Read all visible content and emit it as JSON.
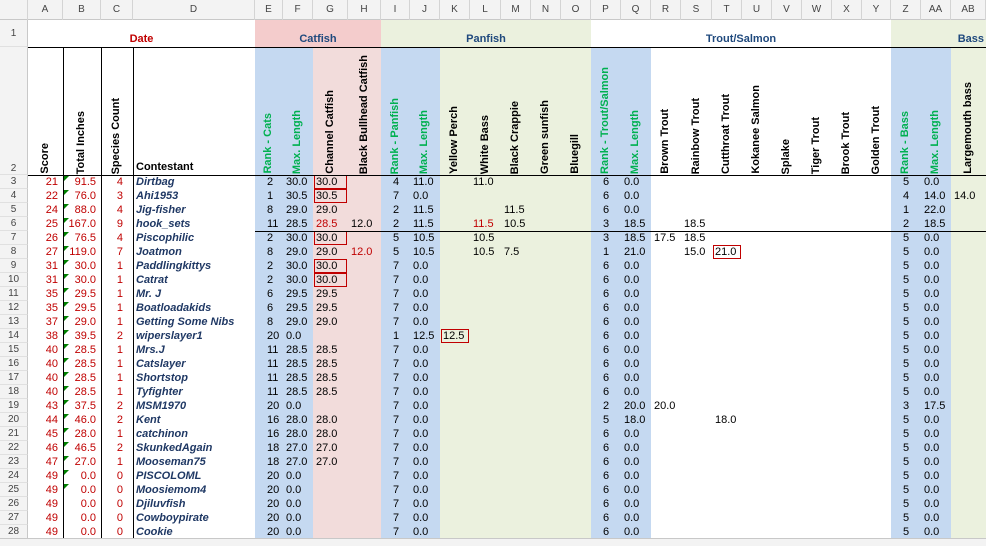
{
  "columns": [
    "A",
    "B",
    "C",
    "D",
    "E",
    "F",
    "G",
    "H",
    "I",
    "J",
    "K",
    "L",
    "M",
    "N",
    "O",
    "P",
    "Q",
    "R",
    "S",
    "T",
    "U",
    "V",
    "W",
    "X",
    "Y",
    "Z",
    "AA",
    "AB"
  ],
  "row_numbers": [
    "1",
    "2",
    "3",
    "4",
    "5",
    "6",
    "7",
    "8",
    "9",
    "10",
    "11",
    "12",
    "13",
    "14",
    "15",
    "16",
    "17",
    "18",
    "19",
    "20",
    "21",
    "22",
    "23",
    "24",
    "25",
    "26",
    "27",
    "28"
  ],
  "groups": {
    "date": "Date",
    "catfish": "Catfish",
    "panfish": "Panfish",
    "trout": "Trout/Salmon",
    "bass": "Bass"
  },
  "headers": {
    "score": "Score",
    "total_inches": "Total Inches",
    "species_count": "Species Count",
    "contestant": "Contestant",
    "rank_cats": "Rank - Cats",
    "max_len_cats": "Max. Length",
    "channel_catfish": "Channel Catfish",
    "black_bullhead": "Black Bullhead Catfish",
    "rank_panfish": "Rank - Panfish",
    "max_len_panfish": "Max. Length",
    "yellow_perch": "Yellow Perch",
    "white_bass": "White Bass",
    "black_crappie": "Black Crappie",
    "green_sunfish": "Green sunfish",
    "bluegill": "Bluegill",
    "rank_trout": "Rank - Trout/Salmon",
    "max_len_trout": "Max. Length",
    "brown_trout": "Brown Trout",
    "rainbow_trout": "Rainbow Trout",
    "cutthroat_trout": "Cutthroat Trout",
    "kokanee": "Kokanee Salmon",
    "splake": "Splake",
    "tiger_trout": "Tiger Trout",
    "brook_trout": "Brook Trout",
    "golden_trout": "Golden Trout",
    "rank_bass": "Rank - Bass",
    "max_len_bass": "Max. Length",
    "largemouth": "Largemouth bass"
  },
  "rows": [
    {
      "score": "21",
      "total": "91.5",
      "count": "4",
      "name": "Dirtbag",
      "e": "2",
      "f": "30.0",
      "g": "30.0",
      "h": "",
      "i": "4",
      "j": "11.0",
      "k": "",
      "l": "11.0",
      "m": "",
      "p": "6",
      "q": "0.0",
      "r": "",
      "s": "",
      "t": "",
      "z": "5",
      "aa": "0.0",
      "ab": ""
    },
    {
      "score": "22",
      "total": "76.0",
      "count": "3",
      "name": "Ahi1953",
      "e": "1",
      "f": "30.5",
      "g": "30.5",
      "h": "",
      "i": "7",
      "j": "0.0",
      "k": "",
      "l": "",
      "m": "",
      "p": "6",
      "q": "0.0",
      "r": "",
      "s": "",
      "t": "",
      "z": "4",
      "aa": "14.0",
      "ab": "14.0"
    },
    {
      "score": "24",
      "total": "88.0",
      "count": "4",
      "name": "Jig-fisher",
      "e": "8",
      "f": "29.0",
      "g": "29.0",
      "h": "",
      "i": "2",
      "j": "11.5",
      "k": "",
      "l": "",
      "m": "11.5",
      "p": "6",
      "q": "0.0",
      "r": "",
      "s": "",
      "t": "",
      "z": "1",
      "aa": "22.0",
      "ab": ""
    },
    {
      "score": "25",
      "total": "167.0",
      "count": "9",
      "name": "hook_sets",
      "e": "11",
      "f": "28.5",
      "g": "28.5",
      "h": "12.0",
      "i": "2",
      "j": "11.5",
      "k": "",
      "l": "11.5",
      "m": "10.5",
      "p": "3",
      "q": "18.5",
      "r": "",
      "s": "18.5",
      "t": "",
      "z": "2",
      "aa": "18.5",
      "ab": ""
    },
    {
      "score": "26",
      "total": "76.5",
      "count": "4",
      "name": "Piscophilic",
      "e": "2",
      "f": "30.0",
      "g": "30.0",
      "h": "",
      "i": "5",
      "j": "10.5",
      "k": "",
      "l": "10.5",
      "m": "",
      "p": "3",
      "q": "18.5",
      "r": "17.5",
      "s": "18.5",
      "t": "",
      "z": "5",
      "aa": "0.0",
      "ab": ""
    },
    {
      "score": "27",
      "total": "119.0",
      "count": "7",
      "name": "Joatmon",
      "e": "8",
      "f": "29.0",
      "g": "29.0",
      "h": "12.0",
      "i": "5",
      "j": "10.5",
      "k": "",
      "l": "10.5",
      "m": "7.5",
      "p": "1",
      "q": "21.0",
      "r": "",
      "s": "15.0",
      "t": "21.0",
      "z": "5",
      "aa": "0.0",
      "ab": ""
    },
    {
      "score": "31",
      "total": "30.0",
      "count": "1",
      "name": "Paddlingkittys",
      "e": "2",
      "f": "30.0",
      "g": "30.0",
      "h": "",
      "i": "7",
      "j": "0.0",
      "k": "",
      "l": "",
      "m": "",
      "p": "6",
      "q": "0.0",
      "r": "",
      "s": "",
      "t": "",
      "z": "5",
      "aa": "0.0",
      "ab": ""
    },
    {
      "score": "31",
      "total": "30.0",
      "count": "1",
      "name": "Catrat",
      "e": "2",
      "f": "30.0",
      "g": "30.0",
      "h": "",
      "i": "7",
      "j": "0.0",
      "k": "",
      "l": "",
      "m": "",
      "p": "6",
      "q": "0.0",
      "r": "",
      "s": "",
      "t": "",
      "z": "5",
      "aa": "0.0",
      "ab": ""
    },
    {
      "score": "35",
      "total": "29.5",
      "count": "1",
      "name": "Mr. J",
      "e": "6",
      "f": "29.5",
      "g": "29.5",
      "h": "",
      "i": "7",
      "j": "0.0",
      "k": "",
      "l": "",
      "m": "",
      "p": "6",
      "q": "0.0",
      "r": "",
      "s": "",
      "t": "",
      "z": "5",
      "aa": "0.0",
      "ab": ""
    },
    {
      "score": "35",
      "total": "29.5",
      "count": "1",
      "name": "Boatloadakids",
      "e": "6",
      "f": "29.5",
      "g": "29.5",
      "h": "",
      "i": "7",
      "j": "0.0",
      "k": "",
      "l": "",
      "m": "",
      "p": "6",
      "q": "0.0",
      "r": "",
      "s": "",
      "t": "",
      "z": "5",
      "aa": "0.0",
      "ab": ""
    },
    {
      "score": "37",
      "total": "29.0",
      "count": "1",
      "name": "Getting Some Nibs",
      "e": "8",
      "f": "29.0",
      "g": "29.0",
      "h": "",
      "i": "7",
      "j": "0.0",
      "k": "",
      "l": "",
      "m": "",
      "p": "6",
      "q": "0.0",
      "r": "",
      "s": "",
      "t": "",
      "z": "5",
      "aa": "0.0",
      "ab": ""
    },
    {
      "score": "38",
      "total": "39.5",
      "count": "2",
      "name": "wiperslayer1",
      "e": "20",
      "f": "0.0",
      "g": "",
      "h": "",
      "i": "1",
      "j": "12.5",
      "k": "12.5",
      "l": "",
      "m": "",
      "p": "6",
      "q": "0.0",
      "r": "",
      "s": "",
      "t": "",
      "z": "5",
      "aa": "0.0",
      "ab": ""
    },
    {
      "score": "40",
      "total": "28.5",
      "count": "1",
      "name": "Mrs.J",
      "e": "11",
      "f": "28.5",
      "g": "28.5",
      "h": "",
      "i": "7",
      "j": "0.0",
      "k": "",
      "l": "",
      "m": "",
      "p": "6",
      "q": "0.0",
      "r": "",
      "s": "",
      "t": "",
      "z": "5",
      "aa": "0.0",
      "ab": ""
    },
    {
      "score": "40",
      "total": "28.5",
      "count": "1",
      "name": "Catslayer",
      "e": "11",
      "f": "28.5",
      "g": "28.5",
      "h": "",
      "i": "7",
      "j": "0.0",
      "k": "",
      "l": "",
      "m": "",
      "p": "6",
      "q": "0.0",
      "r": "",
      "s": "",
      "t": "",
      "z": "5",
      "aa": "0.0",
      "ab": ""
    },
    {
      "score": "40",
      "total": "28.5",
      "count": "1",
      "name": "Shortstop",
      "e": "11",
      "f": "28.5",
      "g": "28.5",
      "h": "",
      "i": "7",
      "j": "0.0",
      "k": "",
      "l": "",
      "m": "",
      "p": "6",
      "q": "0.0",
      "r": "",
      "s": "",
      "t": "",
      "z": "5",
      "aa": "0.0",
      "ab": ""
    },
    {
      "score": "40",
      "total": "28.5",
      "count": "1",
      "name": "Tyfighter",
      "e": "11",
      "f": "28.5",
      "g": "28.5",
      "h": "",
      "i": "7",
      "j": "0.0",
      "k": "",
      "l": "",
      "m": "",
      "p": "6",
      "q": "0.0",
      "r": "",
      "s": "",
      "t": "",
      "z": "5",
      "aa": "0.0",
      "ab": ""
    },
    {
      "score": "43",
      "total": "37.5",
      "count": "2",
      "name": "MSM1970",
      "e": "20",
      "f": "0.0",
      "g": "",
      "h": "",
      "i": "7",
      "j": "0.0",
      "k": "",
      "l": "",
      "m": "",
      "p": "2",
      "q": "20.0",
      "r": "20.0",
      "s": "",
      "t": "",
      "z": "3",
      "aa": "17.5",
      "ab": ""
    },
    {
      "score": "44",
      "total": "46.0",
      "count": "2",
      "name": "Kent",
      "e": "16",
      "f": "28.0",
      "g": "28.0",
      "h": "",
      "i": "7",
      "j": "0.0",
      "k": "",
      "l": "",
      "m": "",
      "p": "5",
      "q": "18.0",
      "r": "",
      "s": "",
      "t": "18.0",
      "z": "5",
      "aa": "0.0",
      "ab": ""
    },
    {
      "score": "45",
      "total": "28.0",
      "count": "1",
      "name": "catchinon",
      "e": "16",
      "f": "28.0",
      "g": "28.0",
      "h": "",
      "i": "7",
      "j": "0.0",
      "k": "",
      "l": "",
      "m": "",
      "p": "6",
      "q": "0.0",
      "r": "",
      "s": "",
      "t": "",
      "z": "5",
      "aa": "0.0",
      "ab": ""
    },
    {
      "score": "46",
      "total": "46.5",
      "count": "2",
      "name": "SkunkedAgain",
      "e": "18",
      "f": "27.0",
      "g": "27.0",
      "h": "",
      "i": "7",
      "j": "0.0",
      "k": "",
      "l": "",
      "m": "",
      "p": "6",
      "q": "0.0",
      "r": "",
      "s": "",
      "t": "",
      "z": "5",
      "aa": "0.0",
      "ab": ""
    },
    {
      "score": "47",
      "total": "27.0",
      "count": "1",
      "name": "Mooseman75",
      "e": "18",
      "f": "27.0",
      "g": "27.0",
      "h": "",
      "i": "7",
      "j": "0.0",
      "k": "",
      "l": "",
      "m": "",
      "p": "6",
      "q": "0.0",
      "r": "",
      "s": "",
      "t": "",
      "z": "5",
      "aa": "0.0",
      "ab": ""
    },
    {
      "score": "49",
      "total": "0.0",
      "count": "0",
      "name": "PISCOLOML",
      "e": "20",
      "f": "0.0",
      "g": "",
      "h": "",
      "i": "7",
      "j": "0.0",
      "k": "",
      "l": "",
      "m": "",
      "p": "6",
      "q": "0.0",
      "r": "",
      "s": "",
      "t": "",
      "z": "5",
      "aa": "0.0",
      "ab": ""
    },
    {
      "score": "49",
      "total": "0.0",
      "count": "0",
      "name": "Moosiemom4",
      "e": "20",
      "f": "0.0",
      "g": "",
      "h": "",
      "i": "7",
      "j": "0.0",
      "k": "",
      "l": "",
      "m": "",
      "p": "6",
      "q": "0.0",
      "r": "",
      "s": "",
      "t": "",
      "z": "5",
      "aa": "0.0",
      "ab": ""
    },
    {
      "score": "49",
      "total": "0.0",
      "count": "0",
      "name": "Djiluvfish",
      "e": "20",
      "f": "0.0",
      "g": "",
      "h": "",
      "i": "7",
      "j": "0.0",
      "k": "",
      "l": "",
      "m": "",
      "p": "6",
      "q": "0.0",
      "r": "",
      "s": "",
      "t": "",
      "z": "5",
      "aa": "0.0",
      "ab": ""
    },
    {
      "score": "49",
      "total": "0.0",
      "count": "0",
      "name": "Cowboypirate",
      "e": "20",
      "f": "0.0",
      "g": "",
      "h": "",
      "i": "7",
      "j": "0.0",
      "k": "",
      "l": "",
      "m": "",
      "p": "6",
      "q": "0.0",
      "r": "",
      "s": "",
      "t": "",
      "z": "5",
      "aa": "0.0",
      "ab": ""
    },
    {
      "score": "49",
      "total": "0.0",
      "count": "0",
      "name": "Cookie",
      "e": "20",
      "f": "0.0",
      "g": "",
      "h": "",
      "i": "7",
      "j": "0.0",
      "k": "",
      "l": "",
      "m": "",
      "p": "6",
      "q": "0.0",
      "r": "",
      "s": "",
      "t": "",
      "z": "5",
      "aa": "0.0",
      "ab": ""
    }
  ],
  "boxed_cells": [
    {
      "row": 0,
      "col": "g"
    },
    {
      "row": 1,
      "col": "g"
    },
    {
      "row": 4,
      "col": "g"
    },
    {
      "row": 6,
      "col": "g"
    },
    {
      "row": 7,
      "col": "g"
    },
    {
      "row": 11,
      "col": "k"
    },
    {
      "row": 5,
      "col": "t"
    }
  ],
  "red_cells": [
    {
      "row": 3,
      "col": "g"
    },
    {
      "row": 3,
      "col": "l"
    },
    {
      "row": 5,
      "col": "h"
    }
  ],
  "colors": {
    "catfish_header": "#f4cccc",
    "catfish_bg": "#f2dcdb",
    "blue_bg": "#c5d9f1",
    "panfish_bg": "#ebf1de",
    "rank_text": "#00b050",
    "group_text": "#1f497d",
    "date_text": "#c00000",
    "score_text": "#c00000",
    "name_text": "#1f3864"
  }
}
